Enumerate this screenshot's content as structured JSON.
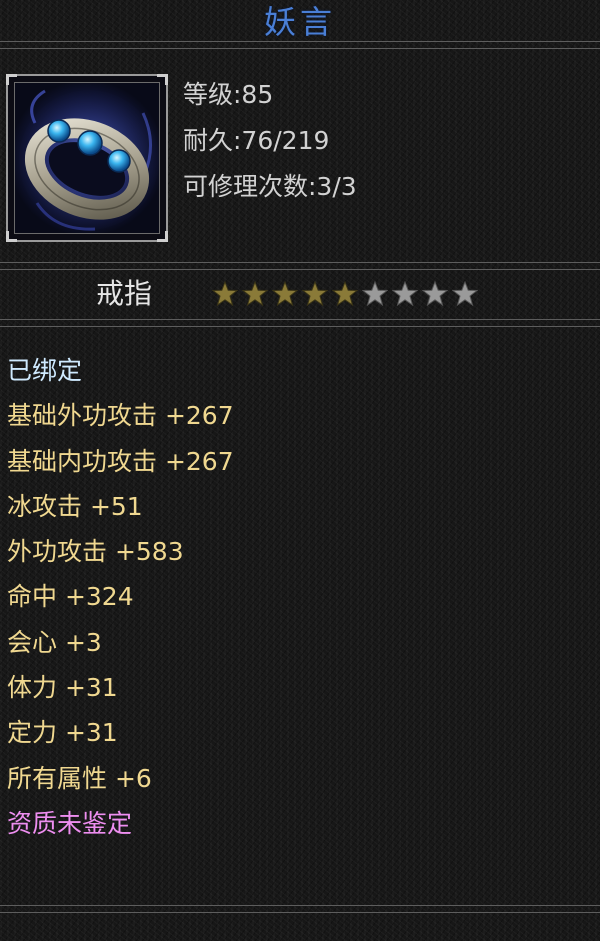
{
  "item": {
    "name": "妖言",
    "icon": "ring-with-blue-gems-icon",
    "level": "等级:85",
    "durability": "耐久:76/219",
    "repairs": "可修理次数:3/3",
    "type": "戒指",
    "stars_filled": 5,
    "stars_total": 9,
    "bound": "已绑定",
    "attributes": [
      {
        "text": "基础外功攻击 +267",
        "color": "#f0d890"
      },
      {
        "text": "基础内功攻击 +267",
        "color": "#f0d890"
      },
      {
        "text": "冰攻击 +51",
        "color": "#f0d890"
      },
      {
        "text": "外功攻击 +583",
        "color": "#f0d890"
      },
      {
        "text": "命中 +324",
        "color": "#f0d890"
      },
      {
        "text": "会心 +3",
        "color": "#f0d890"
      },
      {
        "text": "体力 +31",
        "color": "#f0d890"
      },
      {
        "text": "定力 +31",
        "color": "#f0d890"
      },
      {
        "text": "所有属性 +6",
        "color": "#f0d890"
      }
    ],
    "quality": "资质未鉴定"
  },
  "colors": {
    "title": "#4a7fd6",
    "bound": "#cfeaff",
    "quality": "#ee8ef0",
    "star_filled": "#8a7a38",
    "star_empty": "#9a9a9a"
  }
}
